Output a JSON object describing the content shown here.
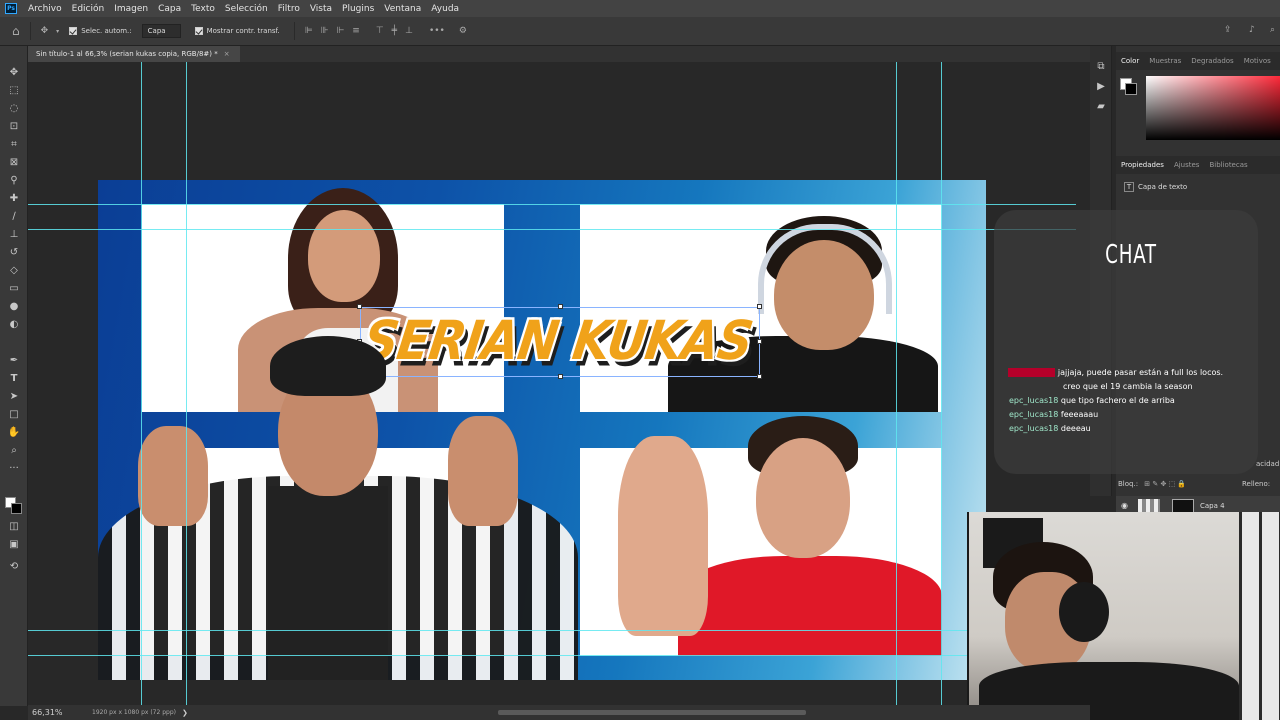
{
  "menubar": {
    "items": [
      "Archivo",
      "Edición",
      "Imagen",
      "Capa",
      "Texto",
      "Selección",
      "Filtro",
      "Vista",
      "Plugins",
      "Ventana",
      "Ayuda"
    ]
  },
  "options": {
    "auto_select_label": "Selec. autom.:",
    "auto_select_value": "Capa",
    "show_transform_label": "Mostrar contr. transf."
  },
  "document": {
    "tab_title": "Sin título-1 al 66,3% (serian kukas copia, RGB/8#) *",
    "close_glyph": "×"
  },
  "artwork": {
    "title": "SERIAN KUKAS"
  },
  "right_panel": {
    "color_tabs": [
      "Color",
      "Muestras",
      "Degradados",
      "Motivos"
    ],
    "props_tabs": [
      "Propiedades",
      "Ajustes",
      "Bibliotecas"
    ],
    "text_layer_label": "Capa de texto",
    "layer_lock_label": "Bloq.:",
    "fill_label": "Relleno:",
    "opacity_fragment": "acidad:",
    "layer_name": "Capa 4"
  },
  "chat": {
    "title": "CHAT",
    "messages": [
      {
        "user": "",
        "text": "jajjaja, puede pasar están a full los locos.",
        "redacted": true
      },
      {
        "user": "",
        "text": "creo que el 19 cambia la season",
        "redacted": false
      },
      {
        "user": "epc_lucas18",
        "text": "que tipo fachero el de arriba",
        "redacted": false
      },
      {
        "user": "epc_lucas18",
        "text": "feeeaaau",
        "redacted": false
      },
      {
        "user": "epc_lucas18",
        "text": "deeeau",
        "redacted": false
      }
    ]
  },
  "status": {
    "zoom": "66,31%",
    "doc_info": "1920 px x 1080 px (72 ppp)"
  },
  "colors": {
    "title_orange": "#f0a21a",
    "guide_cyan": "#5ee7f0",
    "chat_user": "#9fe6c9"
  }
}
